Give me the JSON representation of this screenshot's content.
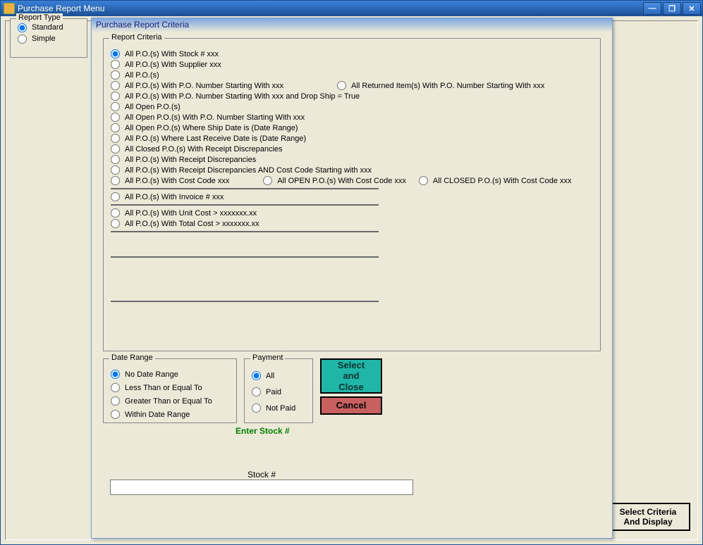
{
  "window": {
    "title": "Purchase Report Menu",
    "min": "—",
    "max": "❐",
    "close": "✕"
  },
  "dialog": {
    "title": "Purchase Report Criteria"
  },
  "criteria": {
    "legend": "Report Criteria",
    "r0": "All P.O.(s) With Stock # xxx",
    "r1": "All P.O.(s) With Supplier xxx",
    "r2": "All P.O.(s)",
    "r3": "All P.O.(s) With P.O. Number Starting With xxx",
    "r3b": "All Returned Item(s) With P.O. Number Starting With xxx",
    "r4": "All P.O.(s) With P.O. Number Starting With xxx and Drop Ship = True",
    "r5": "All Open P.O.(s)",
    "r6": "All Open P.O.(s) With P.O. Number Starting With xxx",
    "r7": "All Open P.O.(s) Where Ship Date is (Date Range)",
    "r8": "All P.O.(s) Where Last Receive Date is (Date Range)",
    "r9": "All  Closed P.O.(s) With Receipt Discrepancies",
    "r10": "All P.O.(s) With Receipt Discrepancies",
    "r11": "All P.O.(s) With Receipt Discrepancies AND Cost Code Starting with xxx",
    "r12": "All P.O.(s) With Cost Code xxx",
    "r12b": "All  OPEN P.O.(s) With Cost Code xxx",
    "r12c": "All  CLOSED P.O.(s) With Cost Code xxx",
    "r13": "All P.O.(s) With Invoice # xxx",
    "r14": "All  P.O.(s) With  Unit Cost > xxxxxxx.xx",
    "r15": "All  P.O.(s) With Total Cost > xxxxxxx.xx"
  },
  "dateRange": {
    "legend": "Date Range",
    "d0": "No Date Range",
    "d1": "Less Than or Equal To",
    "d2": "Greater Than or Equal To",
    "d3": "Within Date Range"
  },
  "payment": {
    "legend": "Payment",
    "p0": "All",
    "p1": "Paid",
    "p2": "Not Paid"
  },
  "buttons": {
    "select": "Select\nand\nClose",
    "cancel": "Cancel",
    "mainSelect": "Select Criteria\nAnd Display"
  },
  "enterStock": "Enter Stock #",
  "stockLabel": "Stock #",
  "reportType": {
    "legend": "Report Type",
    "t0": "Standard",
    "t1": "Simple"
  }
}
